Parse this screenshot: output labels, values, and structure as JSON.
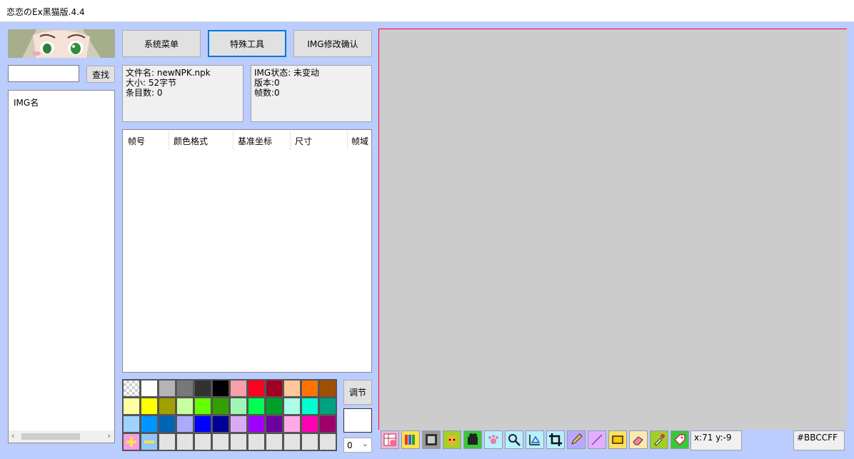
{
  "window": {
    "title": "恋恋のEx黑猫版.4.4"
  },
  "search": {
    "value": "",
    "button_label": "查找"
  },
  "img_list": {
    "header": "IMG名"
  },
  "toolbar": {
    "system_menu": "系统菜单",
    "special_tools": "特殊工具",
    "img_confirm": "IMG修改确认"
  },
  "file_info": {
    "filename": "文件名: newNPK.npk",
    "size": "大小: 52字节",
    "entries": "条目数: 0"
  },
  "img_info": {
    "status": "IMG状态: 未变动",
    "version": "版本:0",
    "frames": "帧数:0"
  },
  "frame_table": {
    "columns": [
      "帧号",
      "颜色格式",
      "基准坐标",
      "尺寸",
      "帧域"
    ]
  },
  "palette": {
    "colors": [
      [
        "transparent",
        "#FFFFFF",
        "#B4B4B4",
        "#787878",
        "#323232",
        "#000000",
        "#F5A0AA",
        "#FF0023",
        "#A00023",
        "#FFC89B",
        "#FF7300",
        "#A05000"
      ],
      [
        "#FFFFA0",
        "#FFFF00",
        "#A0A000",
        "#C8FFA0",
        "#64FF00",
        "#32A000",
        "#A0F5B4",
        "#00FF50",
        "#00A028",
        "#AAFFE6",
        "#00FFD2",
        "#00A082"
      ],
      [
        "#A0D2FF",
        "#0096FF",
        "#0064B4",
        "#AAAAFF",
        "#0000FF",
        "#000096",
        "#DCAAF5",
        "#A000FF",
        "#6E00A0",
        "#FFAAE6",
        "#FF00B4",
        "#A0006E"
      ],
      [
        "add",
        "remove",
        "empty",
        "empty",
        "empty",
        "empty",
        "empty",
        "empty",
        "empty",
        "empty",
        "empty",
        "empty"
      ]
    ],
    "adjust_label": "调节",
    "current_color": "#FFFFFF",
    "select_value": "0"
  },
  "canvas": {
    "background": "#CCCCCC",
    "border_color": "#FF0040"
  },
  "status": {
    "coords": "x:71 y:-9",
    "color_hex": "#BBCCFF"
  },
  "tools": [
    "image-grid-icon",
    "color-bars-icon",
    "film-strip-icon",
    "cat-face-icon",
    "camera-icon",
    "paw-icon",
    "magnifier-icon",
    "move-axes-icon",
    "crop-icon",
    "pencil-icon",
    "line-icon",
    "rectangle-icon",
    "eraser-icon",
    "eyedropper-icon",
    "tag-icon"
  ]
}
